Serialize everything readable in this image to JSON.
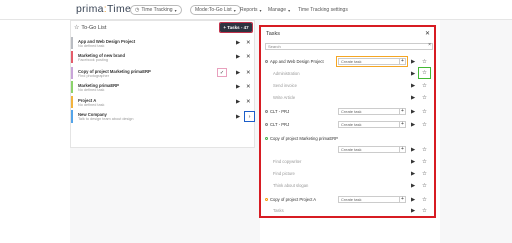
{
  "app": {
    "logo_left": "prima",
    "logo_colon": ":",
    "logo_right": "Time"
  },
  "nav": {
    "time_tracking": "Time Tracking",
    "mode": "Mode:To-Go List",
    "reports": "Reports",
    "manage": "Manage",
    "settings": "Time Tracking settings"
  },
  "left_panel": {
    "title": "To-Go List",
    "tasks_button": "+ Tasks - 47",
    "items": [
      {
        "title": "App and Web Design Project",
        "subtitle": "No defined task",
        "color": "#b9bcc2"
      },
      {
        "title": "Marketing of new brand",
        "subtitle": "Facebook posting",
        "color": "#e45c6a"
      },
      {
        "title": "Copy of project Marketing primaERP",
        "subtitle": "Find photographer",
        "color": "#c9a5d9"
      },
      {
        "title": "Marketing primaERP",
        "subtitle": "No defined task",
        "color": "#8bd36b"
      },
      {
        "title": "Project A",
        "subtitle": "No defined task",
        "color": "#f2b33d"
      },
      {
        "title": "New Company",
        "subtitle": "Talk to design team about design",
        "color": "#53a4ea"
      }
    ]
  },
  "tasks_panel": {
    "title": "Tasks",
    "search_placeholder": "Search",
    "create_placeholder": "Create task",
    "projects": [
      {
        "name": "App and Web Design Project",
        "tasks": [
          "Administration",
          "Send invoice",
          "Write Article"
        ]
      },
      {
        "name": "CLT - PRJ",
        "tasks": []
      },
      {
        "name": "CLT - PRJ",
        "tasks": []
      },
      {
        "name": "Copy of project Marketing primaERP",
        "tasks": [
          "Find copywriter",
          "Find picture",
          "Think about slogan"
        ]
      },
      {
        "name": "Copy of project Project A",
        "tasks": [
          "Tasks"
        ]
      }
    ]
  },
  "icons": {
    "play": "play-icon",
    "close": "close-icon",
    "star": "star-icon",
    "check": "check-icon",
    "arrow": "arrow-right-icon"
  }
}
